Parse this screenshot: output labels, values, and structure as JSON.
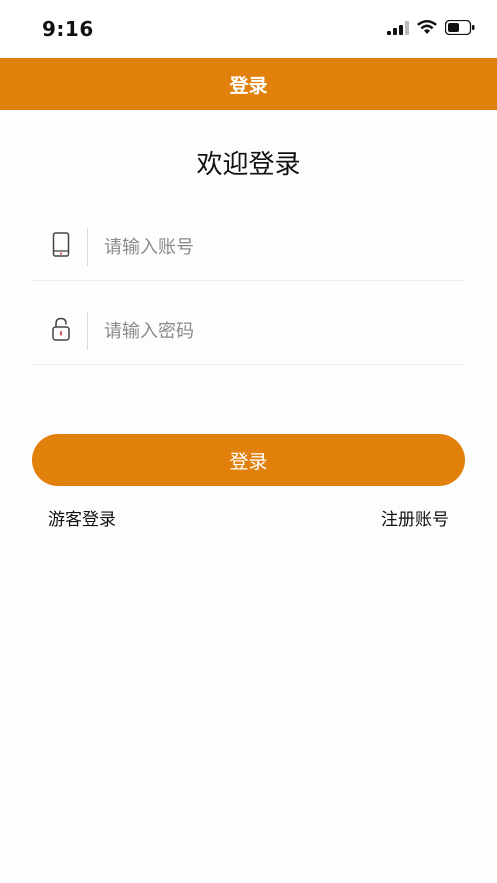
{
  "status_bar": {
    "time": "9:16"
  },
  "header": {
    "title": "登录"
  },
  "welcome": "欢迎登录",
  "account_field": {
    "placeholder": "请输入账号",
    "value": "",
    "icon": "phone-icon"
  },
  "password_field": {
    "placeholder": "请输入密码",
    "value": "",
    "icon": "lock-icon"
  },
  "login_button": "登录",
  "links": {
    "guest": "游客登录",
    "register": "注册账号"
  },
  "colors": {
    "accent": "#e2800c"
  }
}
